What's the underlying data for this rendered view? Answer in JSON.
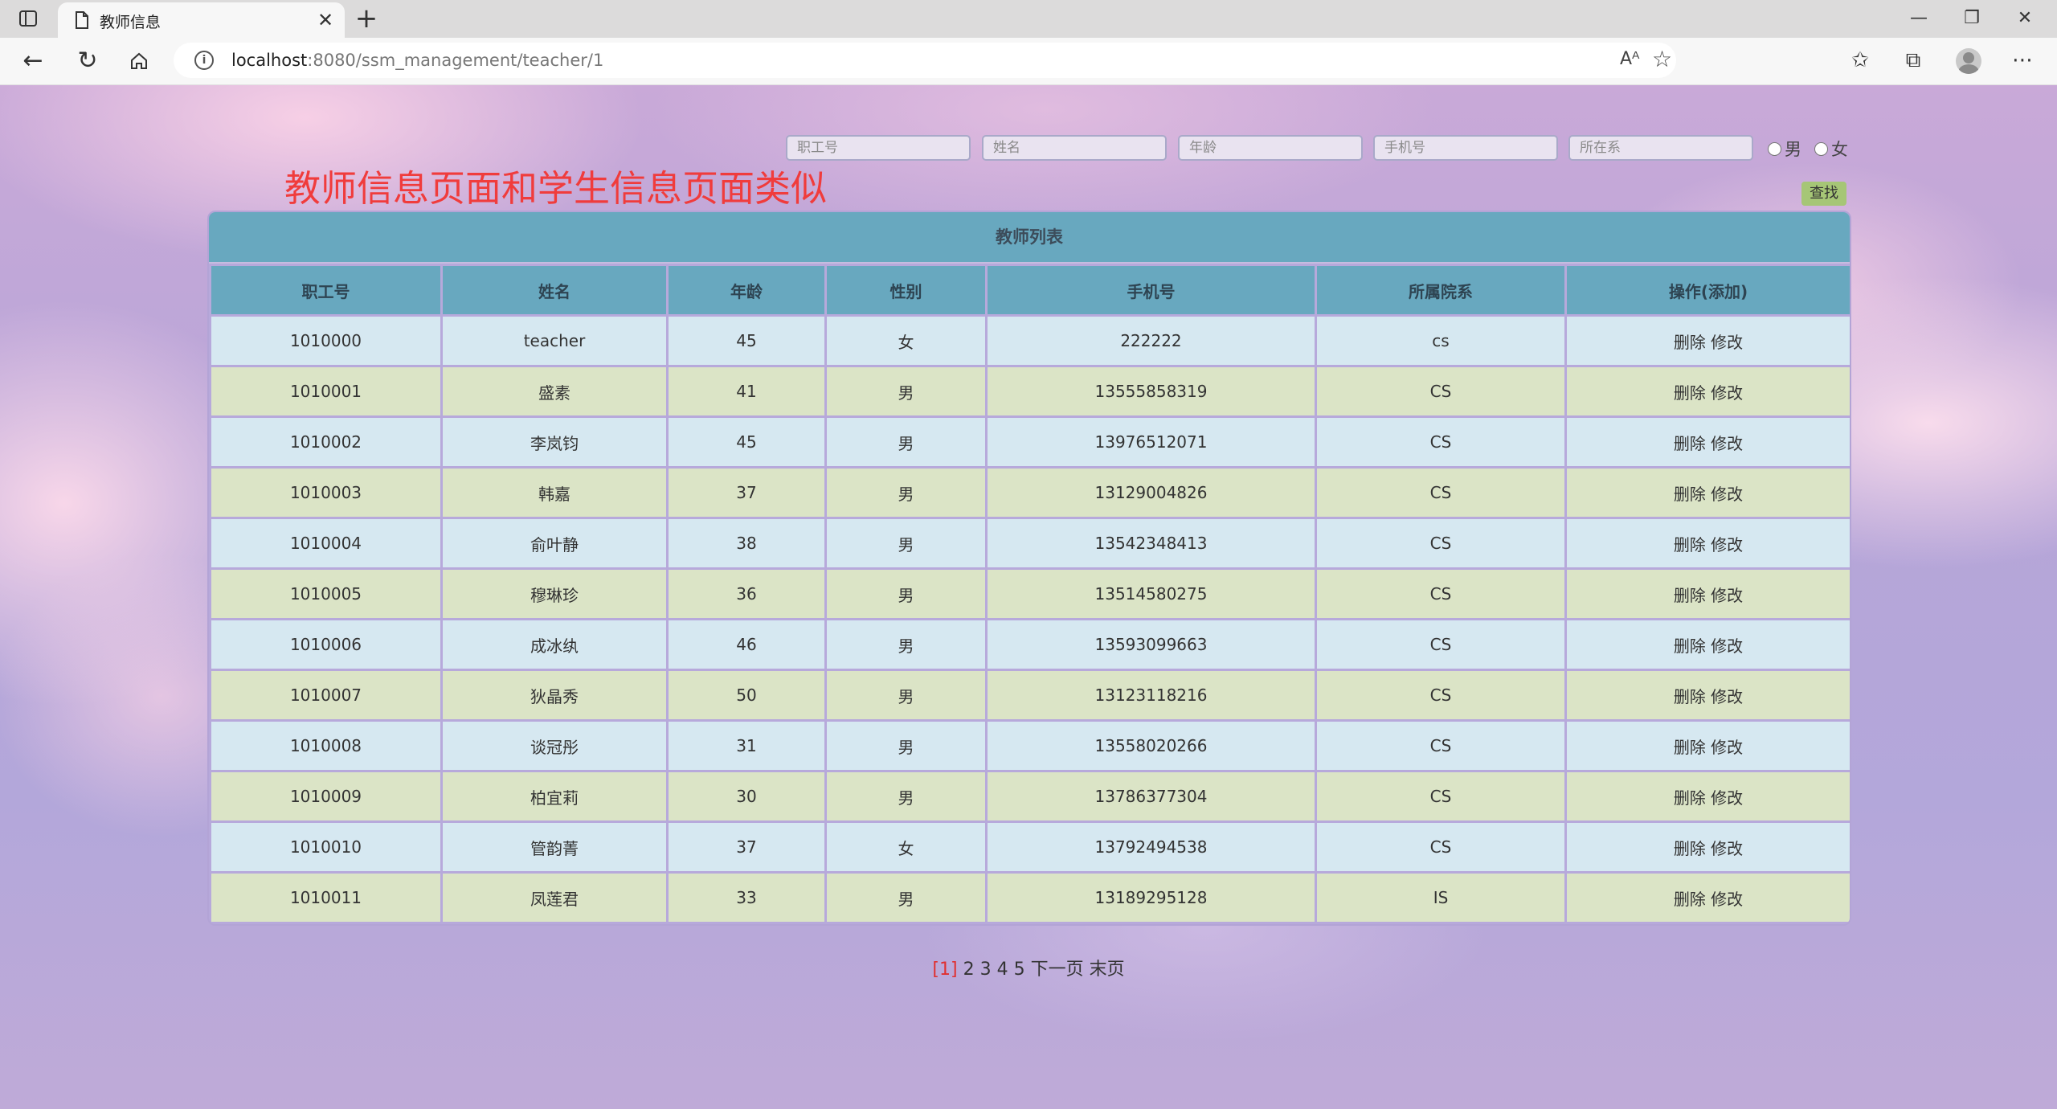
{
  "browser": {
    "tab_title": "教师信息",
    "url_host": "localhost",
    "url_rest": ":8080/ssm_management/teacher/1"
  },
  "search": {
    "placeholders": [
      "职工号",
      "姓名",
      "年龄",
      "手机号",
      "所在系"
    ],
    "gender_options": [
      "男",
      "女"
    ],
    "button_label": "查找"
  },
  "annotation": "教师信息页面和学生信息页面类似",
  "table": {
    "caption": "教师列表",
    "columns": [
      "职工号",
      "姓名",
      "年龄",
      "性别",
      "手机号",
      "所属院系",
      "操作(添加)"
    ],
    "rows": [
      [
        "1010000",
        "teacher",
        "45",
        "女",
        "222222",
        "cs"
      ],
      [
        "1010001",
        "盛素",
        "41",
        "男",
        "13555858319",
        "CS"
      ],
      [
        "1010002",
        "李岚钧",
        "45",
        "男",
        "13976512071",
        "CS"
      ],
      [
        "1010003",
        "韩嘉",
        "37",
        "男",
        "13129004826",
        "CS"
      ],
      [
        "1010004",
        "俞叶静",
        "38",
        "男",
        "13542348413",
        "CS"
      ],
      [
        "1010005",
        "穆琳珍",
        "36",
        "男",
        "13514580275",
        "CS"
      ],
      [
        "1010006",
        "成冰纨",
        "46",
        "男",
        "13593099663",
        "CS"
      ],
      [
        "1010007",
        "狄晶秀",
        "50",
        "男",
        "13123118216",
        "CS"
      ],
      [
        "1010008",
        "谈冠彤",
        "31",
        "男",
        "13558020266",
        "CS"
      ],
      [
        "1010009",
        "柏宜莉",
        "30",
        "男",
        "13786377304",
        "CS"
      ],
      [
        "1010010",
        "管韵菁",
        "37",
        "女",
        "13792494538",
        "CS"
      ],
      [
        "1010011",
        "凤莲君",
        "33",
        "男",
        "13189295128",
        "IS"
      ]
    ],
    "delete_label": "删除",
    "edit_label": "修改"
  },
  "pagination": {
    "current": "[1]",
    "pages": [
      "2",
      "3",
      "4",
      "5"
    ],
    "next": "下一页",
    "last": "末页"
  },
  "colors": {
    "header_blue": "#68a8bf",
    "row_blue": "#d6e8f1",
    "row_green": "#dbe4c6",
    "annotation_red": "#f03c3c",
    "button_green": "#a6c676"
  }
}
